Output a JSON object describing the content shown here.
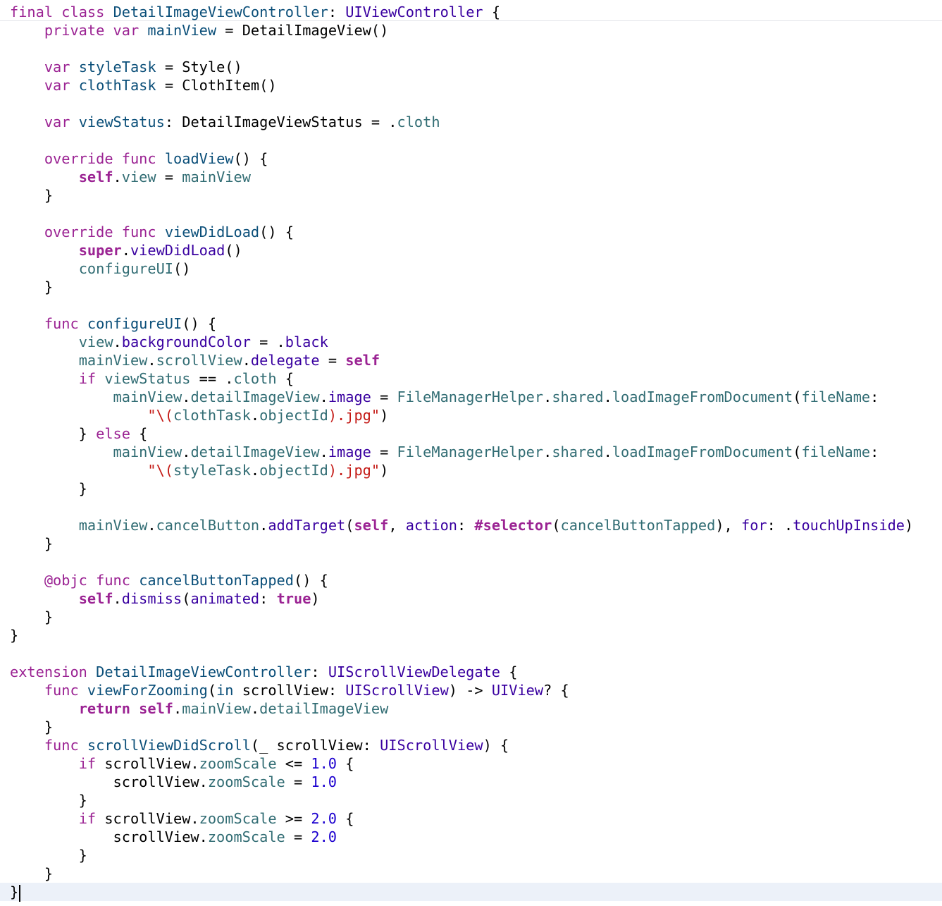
{
  "editor": {
    "language": "swift",
    "colors": {
      "keyword": "#9b2393",
      "declared_type": "#0b4f79",
      "system_type": "#3900a0",
      "identifier": "#326d74",
      "string": "#c41a16",
      "number": "#1c00cf",
      "plain": "#000000",
      "current_line_background": "#ecf1f9"
    },
    "lines": [
      [
        [
          "kw",
          "final"
        ],
        [
          "pl",
          " "
        ],
        [
          "kw",
          "class"
        ],
        [
          "pl",
          " "
        ],
        [
          "ty",
          "DetailImageViewController"
        ],
        [
          "pl",
          ": "
        ],
        [
          "tp",
          "UIViewController"
        ],
        [
          "pl",
          " {"
        ]
      ],
      [
        [
          "pl",
          "    "
        ],
        [
          "kw",
          "private"
        ],
        [
          "pl",
          " "
        ],
        [
          "kw",
          "var"
        ],
        [
          "pl",
          " "
        ],
        [
          "ty",
          "mainView"
        ],
        [
          "pl",
          " = DetailImageView()"
        ]
      ],
      [],
      [
        [
          "pl",
          "    "
        ],
        [
          "kw",
          "var"
        ],
        [
          "pl",
          " "
        ],
        [
          "ty",
          "styleTask"
        ],
        [
          "pl",
          " = Style()"
        ]
      ],
      [
        [
          "pl",
          "    "
        ],
        [
          "kw",
          "var"
        ],
        [
          "pl",
          " "
        ],
        [
          "ty",
          "clothTask"
        ],
        [
          "pl",
          " = ClothItem()"
        ]
      ],
      [],
      [
        [
          "pl",
          "    "
        ],
        [
          "kw",
          "var"
        ],
        [
          "pl",
          " "
        ],
        [
          "ty",
          "viewStatus"
        ],
        [
          "pl",
          ": DetailImageViewStatus = ."
        ],
        [
          "id",
          "cloth"
        ]
      ],
      [],
      [
        [
          "pl",
          "    "
        ],
        [
          "kw",
          "override"
        ],
        [
          "pl",
          " "
        ],
        [
          "kw",
          "func"
        ],
        [
          "pl",
          " "
        ],
        [
          "ty",
          "loadView"
        ],
        [
          "pl",
          "() {"
        ]
      ],
      [
        [
          "pl",
          "        "
        ],
        [
          "kwb",
          "self"
        ],
        [
          "pl",
          "."
        ],
        [
          "id",
          "view"
        ],
        [
          "pl",
          " = "
        ],
        [
          "id",
          "mainView"
        ]
      ],
      [
        [
          "pl",
          "    }"
        ]
      ],
      [],
      [
        [
          "pl",
          "    "
        ],
        [
          "kw",
          "override"
        ],
        [
          "pl",
          " "
        ],
        [
          "kw",
          "func"
        ],
        [
          "pl",
          " "
        ],
        [
          "ty",
          "viewDidLoad"
        ],
        [
          "pl",
          "() {"
        ]
      ],
      [
        [
          "pl",
          "        "
        ],
        [
          "kwb",
          "super"
        ],
        [
          "pl",
          "."
        ],
        [
          "tp",
          "viewDidLoad"
        ],
        [
          "pl",
          "()"
        ]
      ],
      [
        [
          "pl",
          "        "
        ],
        [
          "id",
          "configureUI"
        ],
        [
          "pl",
          "()"
        ]
      ],
      [
        [
          "pl",
          "    }"
        ]
      ],
      [],
      [
        [
          "pl",
          "    "
        ],
        [
          "kw",
          "func"
        ],
        [
          "pl",
          " "
        ],
        [
          "ty",
          "configureUI"
        ],
        [
          "pl",
          "() {"
        ]
      ],
      [
        [
          "pl",
          "        "
        ],
        [
          "id",
          "view"
        ],
        [
          "pl",
          "."
        ],
        [
          "tp",
          "backgroundColor"
        ],
        [
          "pl",
          " = ."
        ],
        [
          "tp",
          "black"
        ]
      ],
      [
        [
          "pl",
          "        "
        ],
        [
          "id",
          "mainView"
        ],
        [
          "pl",
          "."
        ],
        [
          "id",
          "scrollView"
        ],
        [
          "pl",
          "."
        ],
        [
          "tp",
          "delegate"
        ],
        [
          "pl",
          " = "
        ],
        [
          "kwb",
          "self"
        ]
      ],
      [
        [
          "pl",
          "        "
        ],
        [
          "kw",
          "if"
        ],
        [
          "pl",
          " "
        ],
        [
          "id",
          "viewStatus"
        ],
        [
          "pl",
          " == ."
        ],
        [
          "id",
          "cloth"
        ],
        [
          "pl",
          " {"
        ]
      ],
      [
        [
          "pl",
          "            "
        ],
        [
          "id",
          "mainView"
        ],
        [
          "pl",
          "."
        ],
        [
          "id",
          "detailImageView"
        ],
        [
          "pl",
          "."
        ],
        [
          "tp",
          "image"
        ],
        [
          "pl",
          " = "
        ],
        [
          "id",
          "FileManagerHelper"
        ],
        [
          "pl",
          "."
        ],
        [
          "id",
          "shared"
        ],
        [
          "pl",
          "."
        ],
        [
          "id",
          "loadImageFromDocument"
        ],
        [
          "pl",
          "("
        ],
        [
          "id",
          "fileName"
        ],
        [
          "pl",
          ":"
        ]
      ],
      [
        [
          "pl",
          "                "
        ],
        [
          "st",
          "\"\\("
        ],
        [
          "id",
          "clothTask"
        ],
        [
          "pl",
          "."
        ],
        [
          "id",
          "objectId"
        ],
        [
          "st",
          ").jpg\""
        ],
        [
          "pl",
          ")"
        ]
      ],
      [
        [
          "pl",
          "        } "
        ],
        [
          "kw",
          "else"
        ],
        [
          "pl",
          " {"
        ]
      ],
      [
        [
          "pl",
          "            "
        ],
        [
          "id",
          "mainView"
        ],
        [
          "pl",
          "."
        ],
        [
          "id",
          "detailImageView"
        ],
        [
          "pl",
          "."
        ],
        [
          "tp",
          "image"
        ],
        [
          "pl",
          " = "
        ],
        [
          "id",
          "FileManagerHelper"
        ],
        [
          "pl",
          "."
        ],
        [
          "id",
          "shared"
        ],
        [
          "pl",
          "."
        ],
        [
          "id",
          "loadImageFromDocument"
        ],
        [
          "pl",
          "("
        ],
        [
          "id",
          "fileName"
        ],
        [
          "pl",
          ":"
        ]
      ],
      [
        [
          "pl",
          "                "
        ],
        [
          "st",
          "\"\\("
        ],
        [
          "id",
          "styleTask"
        ],
        [
          "pl",
          "."
        ],
        [
          "id",
          "objectId"
        ],
        [
          "st",
          ").jpg\""
        ],
        [
          "pl",
          ")"
        ]
      ],
      [
        [
          "pl",
          "        }"
        ]
      ],
      [],
      [
        [
          "pl",
          "        "
        ],
        [
          "id",
          "mainView"
        ],
        [
          "pl",
          "."
        ],
        [
          "id",
          "cancelButton"
        ],
        [
          "pl",
          "."
        ],
        [
          "tp",
          "addTarget"
        ],
        [
          "pl",
          "("
        ],
        [
          "kwb",
          "self"
        ],
        [
          "pl",
          ", "
        ],
        [
          "tp",
          "action"
        ],
        [
          "pl",
          ": "
        ],
        [
          "kwb",
          "#selector"
        ],
        [
          "pl",
          "("
        ],
        [
          "id",
          "cancelButtonTapped"
        ],
        [
          "pl",
          "), "
        ],
        [
          "tp",
          "for"
        ],
        [
          "pl",
          ": ."
        ],
        [
          "tp",
          "touchUpInside"
        ],
        [
          "pl",
          ")"
        ]
      ],
      [
        [
          "pl",
          "    }"
        ]
      ],
      [],
      [
        [
          "pl",
          "    "
        ],
        [
          "kw",
          "@objc"
        ],
        [
          "pl",
          " "
        ],
        [
          "kw",
          "func"
        ],
        [
          "pl",
          " "
        ],
        [
          "ty",
          "cancelButtonTapped"
        ],
        [
          "pl",
          "() {"
        ]
      ],
      [
        [
          "pl",
          "        "
        ],
        [
          "kwb",
          "self"
        ],
        [
          "pl",
          "."
        ],
        [
          "tp",
          "dismiss"
        ],
        [
          "pl",
          "("
        ],
        [
          "tp",
          "animated"
        ],
        [
          "pl",
          ": "
        ],
        [
          "kwb",
          "true"
        ],
        [
          "pl",
          ")"
        ]
      ],
      [
        [
          "pl",
          "    }"
        ]
      ],
      [
        [
          "pl",
          "}"
        ]
      ],
      [],
      [
        [
          "kw",
          "extension"
        ],
        [
          "pl",
          " "
        ],
        [
          "ty",
          "DetailImageViewController"
        ],
        [
          "pl",
          ": "
        ],
        [
          "tp",
          "UIScrollViewDelegate"
        ],
        [
          "pl",
          " {"
        ]
      ],
      [
        [
          "pl",
          "    "
        ],
        [
          "kw",
          "func"
        ],
        [
          "pl",
          " "
        ],
        [
          "ty",
          "viewForZooming"
        ],
        [
          "pl",
          "("
        ],
        [
          "ty",
          "in"
        ],
        [
          "pl",
          " scrollView: "
        ],
        [
          "tp",
          "UIScrollView"
        ],
        [
          "pl",
          ") -> "
        ],
        [
          "tp",
          "UIView"
        ],
        [
          "pl",
          "? {"
        ]
      ],
      [
        [
          "pl",
          "        "
        ],
        [
          "kwb",
          "return"
        ],
        [
          "pl",
          " "
        ],
        [
          "kwb",
          "self"
        ],
        [
          "pl",
          "."
        ],
        [
          "id",
          "mainView"
        ],
        [
          "pl",
          "."
        ],
        [
          "id",
          "detailImageView"
        ]
      ],
      [
        [
          "pl",
          "    }"
        ]
      ],
      [
        [
          "pl",
          "    "
        ],
        [
          "kw",
          "func"
        ],
        [
          "pl",
          " "
        ],
        [
          "ty",
          "scrollViewDidScroll"
        ],
        [
          "pl",
          "(_ scrollView: "
        ],
        [
          "tp",
          "UIScrollView"
        ],
        [
          "pl",
          ") {"
        ]
      ],
      [
        [
          "pl",
          "        "
        ],
        [
          "kw",
          "if"
        ],
        [
          "pl",
          " scrollView."
        ],
        [
          "id",
          "zoomScale"
        ],
        [
          "pl",
          " <= "
        ],
        [
          "nm",
          "1.0"
        ],
        [
          "pl",
          " {"
        ]
      ],
      [
        [
          "pl",
          "            scrollView."
        ],
        [
          "id",
          "zoomScale"
        ],
        [
          "pl",
          " = "
        ],
        [
          "nm",
          "1.0"
        ]
      ],
      [
        [
          "pl",
          "        }"
        ]
      ],
      [
        [
          "pl",
          "        "
        ],
        [
          "kw",
          "if"
        ],
        [
          "pl",
          " scrollView."
        ],
        [
          "id",
          "zoomScale"
        ],
        [
          "pl",
          " >= "
        ],
        [
          "nm",
          "2.0"
        ],
        [
          "pl",
          " {"
        ]
      ],
      [
        [
          "pl",
          "            scrollView."
        ],
        [
          "id",
          "zoomScale"
        ],
        [
          "pl",
          " = "
        ],
        [
          "nm",
          "2.0"
        ]
      ],
      [
        [
          "pl",
          "        }"
        ]
      ],
      [
        [
          "pl",
          "    }"
        ]
      ],
      [
        [
          "pl",
          "}"
        ]
      ]
    ],
    "current_line_index": 48
  }
}
